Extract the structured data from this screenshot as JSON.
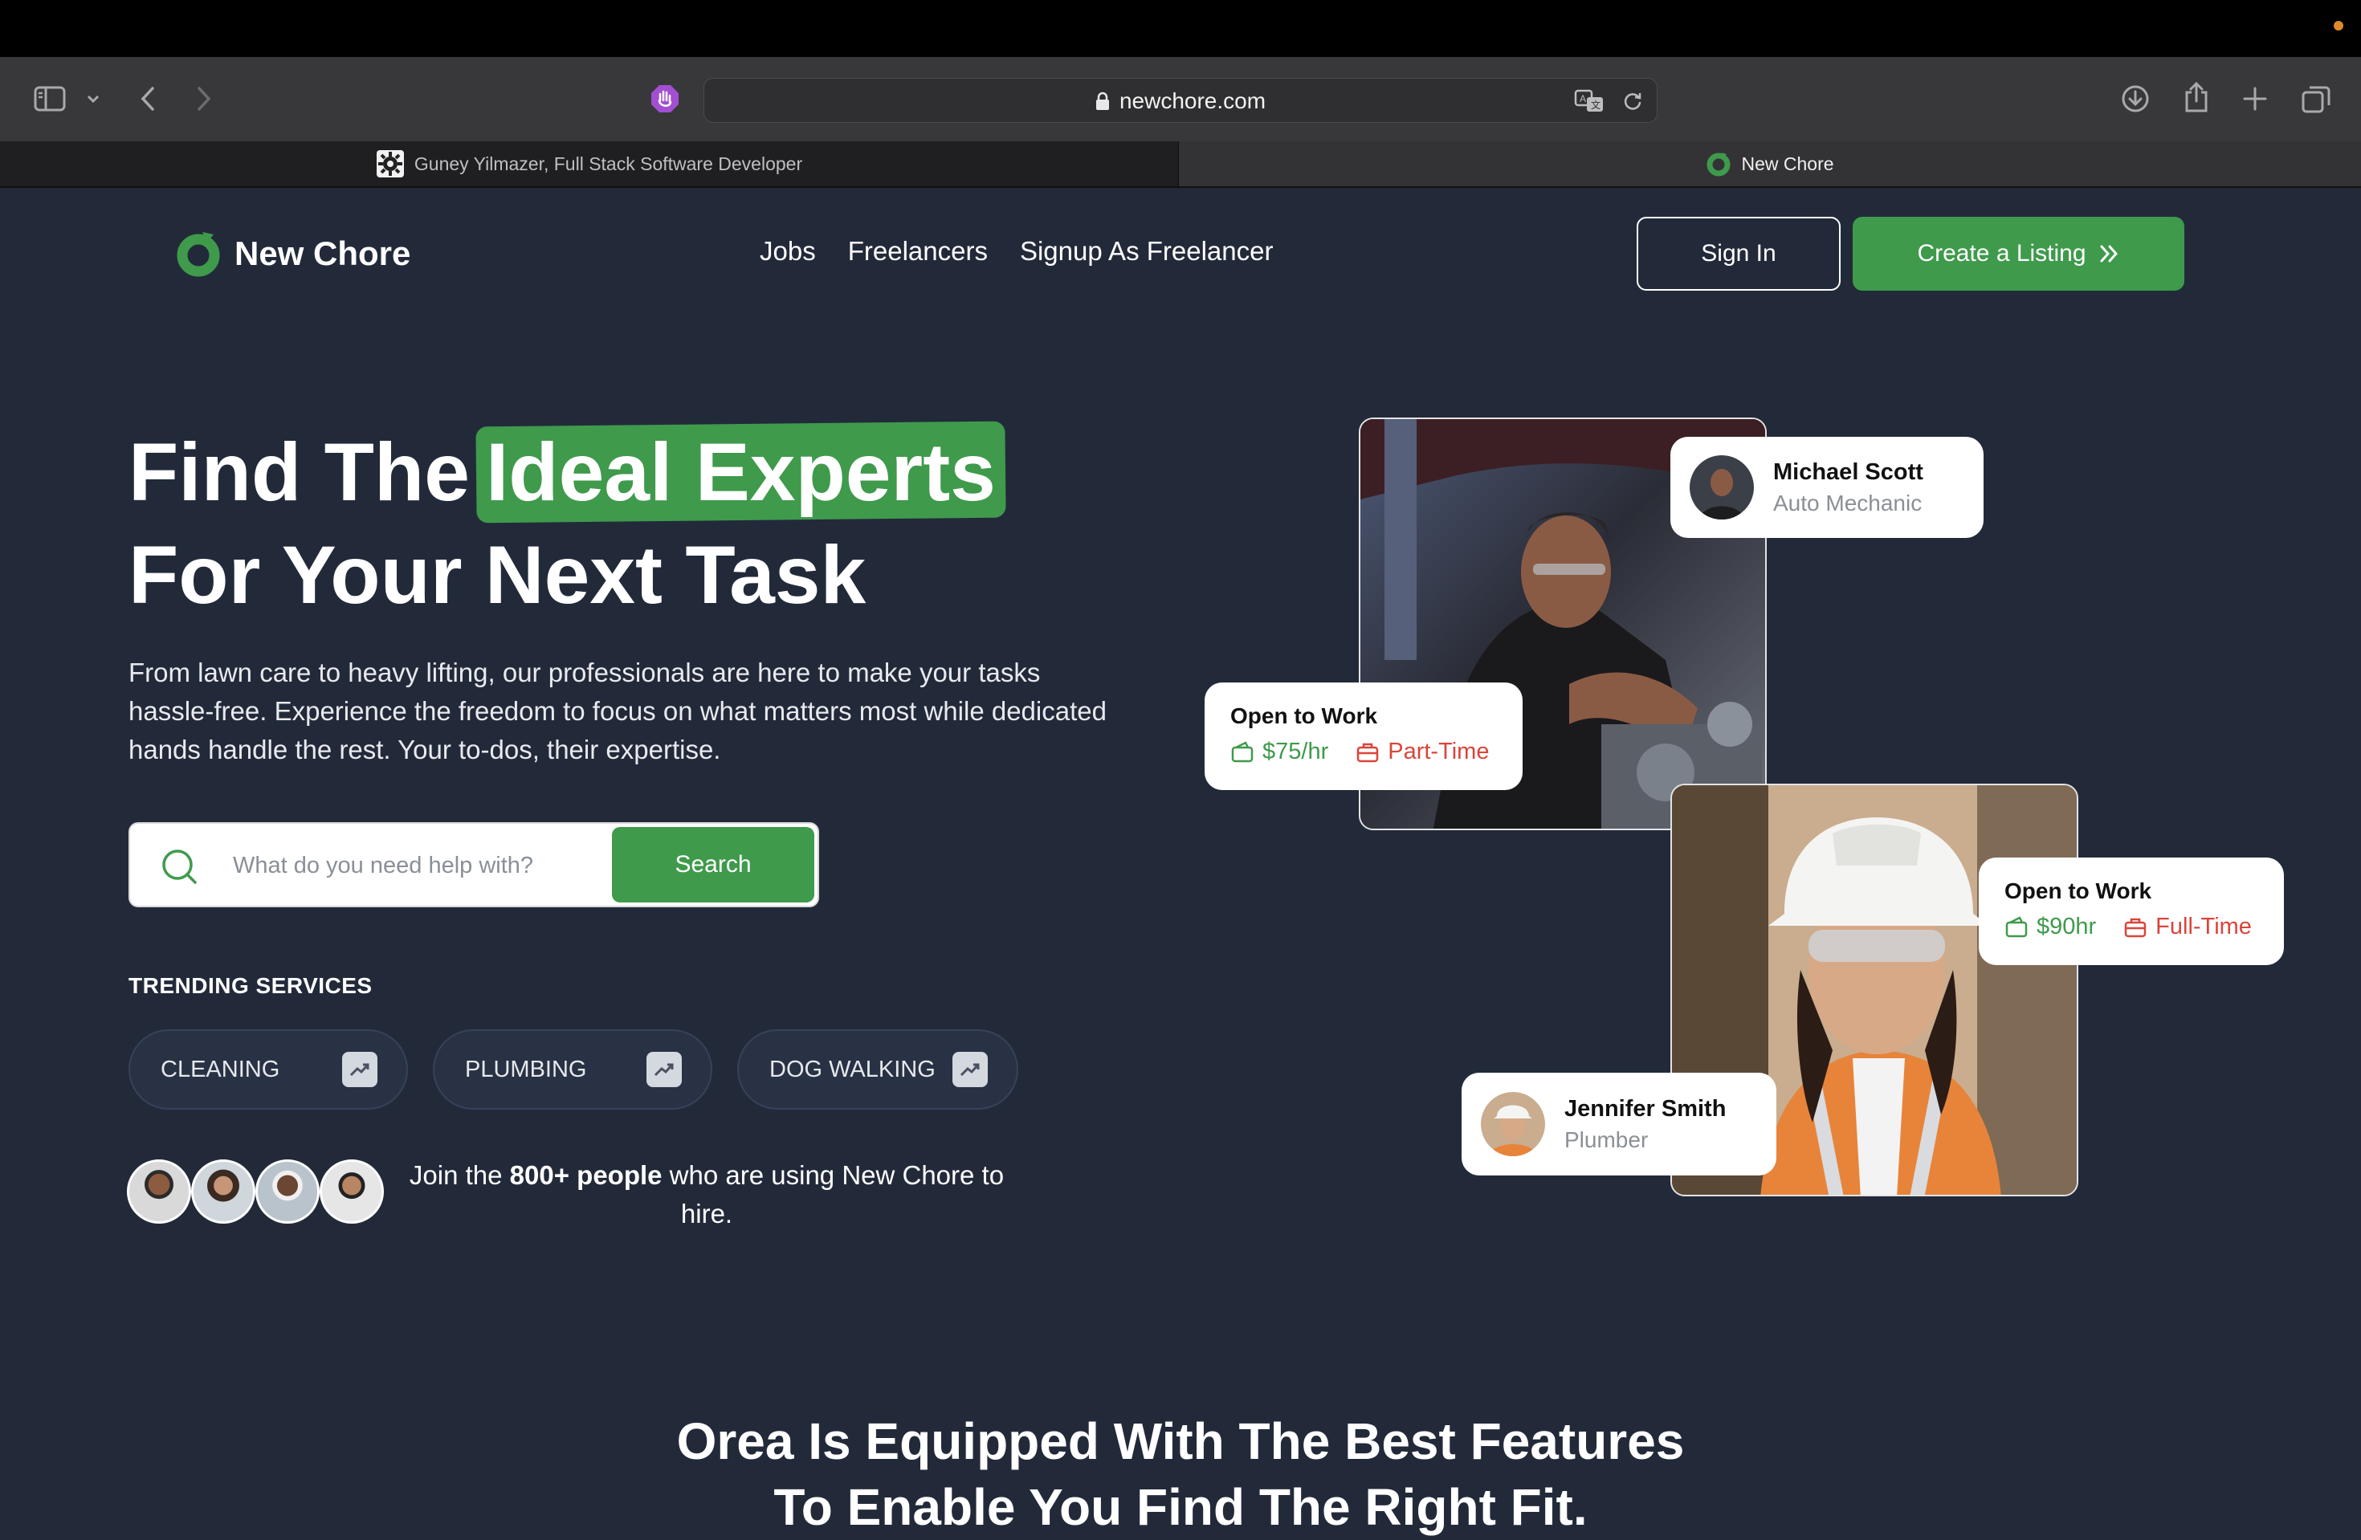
{
  "browser": {
    "url": "newchore.com",
    "tabs": [
      {
        "label": "Guney Yilmazer, Full Stack Software Developer",
        "active": false
      },
      {
        "label": "New Chore",
        "active": true
      }
    ]
  },
  "site": {
    "brand": "New Chore",
    "brand_color": "#3f9a4c",
    "nav": [
      "Jobs",
      "Freelancers",
      "Signup As Freelancer"
    ],
    "sign_in": "Sign In",
    "create_listing": "Create a Listing",
    "hero": {
      "title_prefix": "Find The",
      "title_highlight": "Ideal Experts",
      "title_line2": "For Your Next Task",
      "description": "From lawn care to heavy lifting, our professionals are here to make your tasks hassle-free. Experience the freedom to focus on what matters most while dedicated hands handle the rest. Your to-dos, their expertise."
    },
    "search": {
      "placeholder": "What do you need help with?",
      "button": "Search"
    },
    "trending": {
      "title": "TRENDING SERVICES",
      "items": [
        "CLEANING",
        "PLUMBING",
        "DOG WALKING"
      ]
    },
    "social_proof": {
      "before": "Join the ",
      "bold": "800+ people",
      "after": " who are using New Chore to hire."
    },
    "cards": {
      "michael": {
        "name": "Michael Scott",
        "role": "Auto Mechanic"
      },
      "job1": {
        "status": "Open to Work",
        "rate": "$75/hr",
        "type": "Part-Time"
      },
      "job2": {
        "status": "Open to Work",
        "rate": "$90hr",
        "type": "Full-Time"
      },
      "jennifer": {
        "name": "Jennifer Smith",
        "role": "Plumber"
      }
    },
    "features_heading": {
      "line1": "Orea Is Equipped With The Best Features",
      "line2": "To Enable You Find The Right Fit."
    }
  }
}
